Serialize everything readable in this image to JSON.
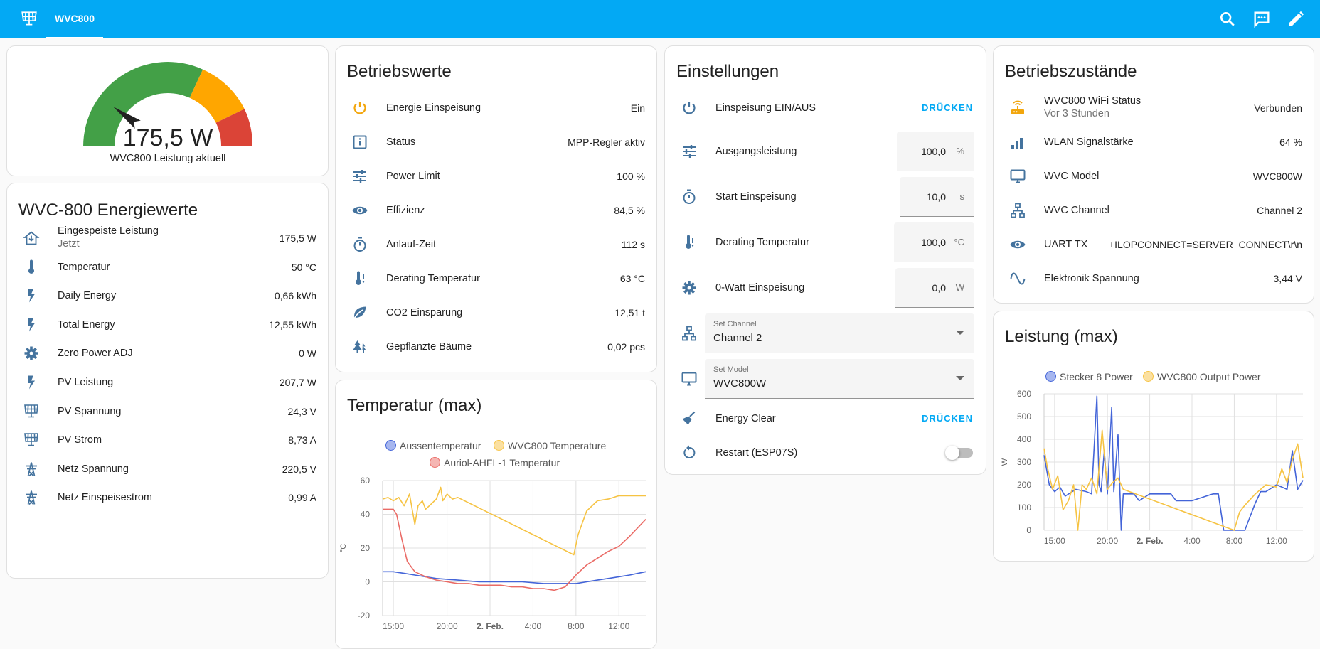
{
  "header": {
    "tab_label": "WVC800",
    "bg_color": "#03a9f4",
    "icons": [
      "solar-panel-icon",
      "search-icon",
      "assist-chat-icon",
      "pencil-icon"
    ]
  },
  "gauge": {
    "value_text": "175,5 W",
    "label": "WVC800 Leistung aktuell",
    "needle_fraction": 0.2,
    "colors": {
      "green": "#43a047",
      "yellow": "#ffa600",
      "red": "#db4437"
    }
  },
  "energy": {
    "title": "WVC-800 Energiewerte",
    "rows": [
      {
        "icon": "home-import-icon",
        "name": "Eingespeiste Leistung",
        "sub": "Jetzt",
        "value": "175,5 W"
      },
      {
        "icon": "thermometer-icon",
        "name": "Temperatur",
        "value": "50 °C"
      },
      {
        "icon": "flash-icon",
        "name": "Daily Energy",
        "value": "0,66 kWh"
      },
      {
        "icon": "flash-icon",
        "name": "Total Energy",
        "value": "12,55 kWh"
      },
      {
        "icon": "gear-icon",
        "name": "Zero Power ADJ",
        "value": "0 W"
      },
      {
        "icon": "flash-icon",
        "name": "PV Leistung",
        "value": "207,7 W"
      },
      {
        "icon": "solar-panel-icon",
        "name": "PV Spannung",
        "value": "24,3 V"
      },
      {
        "icon": "solar-panel-icon",
        "name": "PV Strom",
        "value": "8,73 A"
      },
      {
        "icon": "transmission-tower-icon",
        "name": "Netz Spannung",
        "value": "220,5 V"
      },
      {
        "icon": "transmission-tower-icon",
        "name": "Netz Einspeisestrom",
        "value": "0,99 A"
      }
    ]
  },
  "betrieb": {
    "title": "Betriebswerte",
    "rows": [
      {
        "icon": "power-icon",
        "name": "Energie Einspeisung",
        "value": "Ein"
      },
      {
        "icon": "info-icon",
        "name": "Status",
        "value": "MPP-Regler aktiv"
      },
      {
        "icon": "tune-icon",
        "name": "Power Limit",
        "value": "100 %"
      },
      {
        "icon": "eye-icon",
        "name": "Effizienz",
        "value": "84,5 %"
      },
      {
        "icon": "timer-icon",
        "name": "Anlauf-Zeit",
        "value": "112 s"
      },
      {
        "icon": "thermometer-alert-icon",
        "name": "Derating Temperatur",
        "value": "63 °C"
      },
      {
        "icon": "leaf-icon",
        "name": "CO2 Einsparung",
        "value": "12,51 t"
      },
      {
        "icon": "pine-tree-icon",
        "name": "Gepflanzte Bäume",
        "value": "0,02 pcs"
      }
    ]
  },
  "settings": {
    "title": "Einstellungen",
    "press_label": "DRÜCKEN",
    "einspeisung": "Einspeisung EIN/AUS",
    "ausgang": {
      "name": "Ausgangsleistung",
      "value": "100,0",
      "unit": "%"
    },
    "start": {
      "name": "Start Einspeisung",
      "value": "10,0",
      "unit": "s"
    },
    "derating": {
      "name": "Derating Temperatur",
      "value": "100,0",
      "unit": "°C"
    },
    "zero": {
      "name": "0-Watt Einspeisung",
      "value": "0,0",
      "unit": "W"
    },
    "channel": {
      "label": "Set Channel",
      "value": "Channel 2"
    },
    "model": {
      "label": "Set Model",
      "value": "WVC800W"
    },
    "clear": "Energy Clear",
    "restart": "Restart (ESP07S)",
    "restart_on": false
  },
  "zustand": {
    "title": "Betriebszustände",
    "rows": [
      {
        "icon": "router-wireless-icon",
        "name": "WVC800 WiFi Status",
        "sub": "Vor 3 Stunden",
        "value": "Verbunden"
      },
      {
        "icon": "signal-bars-icon",
        "name": "WLAN Signalstärke",
        "value": "64 %"
      },
      {
        "icon": "monitor-icon",
        "name": "WVC Model",
        "value": "WVC800W"
      },
      {
        "icon": "network-icon",
        "name": "WVC Channel",
        "value": "Channel 2"
      },
      {
        "icon": "eye-icon",
        "name": "UART TX",
        "value": "+ILOPCONNECT=SERVER_CONNECT\\r\\n"
      },
      {
        "icon": "sine-wave-icon",
        "name": "Elektronik Spannung",
        "value": "3,44 V"
      }
    ]
  },
  "chart_data": [
    {
      "type": "line",
      "title": "Temperatur (max)",
      "ylabel": "°C",
      "ylim": [
        -20,
        60
      ],
      "yticks": [
        "60",
        "40",
        "20",
        "0",
        "-20"
      ],
      "xticks": [
        "15:00",
        "20:00",
        "2. Feb.",
        "4:00",
        "8:00",
        "12:00"
      ],
      "series": [
        {
          "name": "Aussentemperatur",
          "color": "#4364d8",
          "x": [
            14.0,
            15.0,
            16.0,
            17.0,
            19.0,
            21.0,
            23.0,
            25.0,
            27.0,
            29.0,
            31.0,
            32.0,
            33.0,
            34.0,
            35.0,
            36.0,
            37.0,
            38.5
          ],
          "y": [
            6,
            6,
            5,
            4,
            2,
            1,
            0,
            0,
            0,
            -1,
            -1,
            -1,
            0,
            1,
            2,
            3,
            4,
            6
          ]
        },
        {
          "name": "WVC800 Temperature",
          "color": "#f6c343",
          "x": [
            14.0,
            14.5,
            15.0,
            15.5,
            16.0,
            16.5,
            17.0,
            17.3,
            17.7,
            18.0,
            18.5,
            19.0,
            19.4,
            19.6,
            20.0,
            20.5,
            21.0,
            31.8,
            32.2,
            33.0,
            34.0,
            35.0,
            36.0,
            37.0,
            38.5
          ],
          "y": [
            49,
            50,
            48,
            50,
            45,
            52,
            34,
            45,
            48,
            43,
            46,
            49,
            56,
            48,
            52,
            49,
            50,
            16,
            28,
            42,
            48,
            49,
            51,
            51,
            51
          ]
        },
        {
          "name": "Auriol-AHFL-1 Temperatur",
          "color": "#ea6b66",
          "x": [
            14.0,
            15.0,
            15.3,
            15.8,
            16.3,
            17.0,
            18.0,
            19.0,
            20.0,
            21.0,
            22.0,
            23.0,
            25.0,
            26.0,
            27.0,
            28.0,
            29.0,
            30.0,
            31.0,
            32.0,
            33.0,
            34.0,
            35.0,
            36.0,
            37.0,
            38.5
          ],
          "y": [
            43,
            43,
            40,
            25,
            12,
            6,
            3,
            1,
            0,
            -1,
            -1,
            -2,
            -2,
            -3,
            -3,
            -4,
            -4,
            -5,
            -3,
            4,
            10,
            14,
            18,
            21,
            27,
            37
          ]
        }
      ]
    },
    {
      "type": "line",
      "title": "Leistung (max)",
      "ylabel": "W",
      "ylim": [
        0,
        600
      ],
      "yticks": [
        "600",
        "500",
        "400",
        "300",
        "200",
        "100",
        "0"
      ],
      "xticks": [
        "15:00",
        "20:00",
        "2. Feb.",
        "4:00",
        "8:00",
        "12:00"
      ],
      "series": [
        {
          "name": "Stecker 8 Power",
          "color": "#4364d8",
          "x": [
            14.0,
            14.5,
            15.0,
            15.5,
            16.0,
            17.0,
            18.0,
            18.5,
            19.0,
            19.2,
            19.4,
            19.7,
            20.0,
            20.4,
            20.6,
            21.0,
            21.3,
            21.5,
            21.8,
            22.0,
            22.5,
            23.0,
            24.0,
            26.0,
            26.5,
            28.0,
            30.0,
            30.5,
            31.0,
            32.0,
            33.0,
            34.0,
            34.5,
            35.0,
            36.0,
            37.0,
            37.5,
            38.0,
            38.5
          ],
          "y": [
            330,
            200,
            170,
            190,
            150,
            180,
            170,
            160,
            590,
            200,
            170,
            350,
            160,
            540,
            170,
            420,
            0,
            160,
            160,
            160,
            160,
            130,
            160,
            160,
            130,
            130,
            160,
            160,
            0,
            0,
            0,
            120,
            170,
            170,
            200,
            180,
            350,
            180,
            220
          ]
        },
        {
          "name": "WVC800 Output Power",
          "color": "#f6c343",
          "x": [
            14.0,
            14.3,
            14.8,
            15.3,
            15.8,
            16.3,
            16.8,
            17.2,
            17.6,
            18.0,
            18.5,
            19.0,
            19.5,
            20.0,
            20.5,
            21.0,
            21.5,
            32.0,
            32.5,
            33.0,
            34.0,
            35.0,
            36.0,
            36.5,
            37.0,
            37.5,
            38.0,
            38.5
          ],
          "y": [
            360,
            280,
            180,
            240,
            90,
            130,
            200,
            0,
            200,
            180,
            230,
            160,
            440,
            180,
            210,
            230,
            180,
            0,
            80,
            110,
            160,
            200,
            190,
            270,
            210,
            310,
            380,
            230
          ]
        }
      ]
    }
  ]
}
